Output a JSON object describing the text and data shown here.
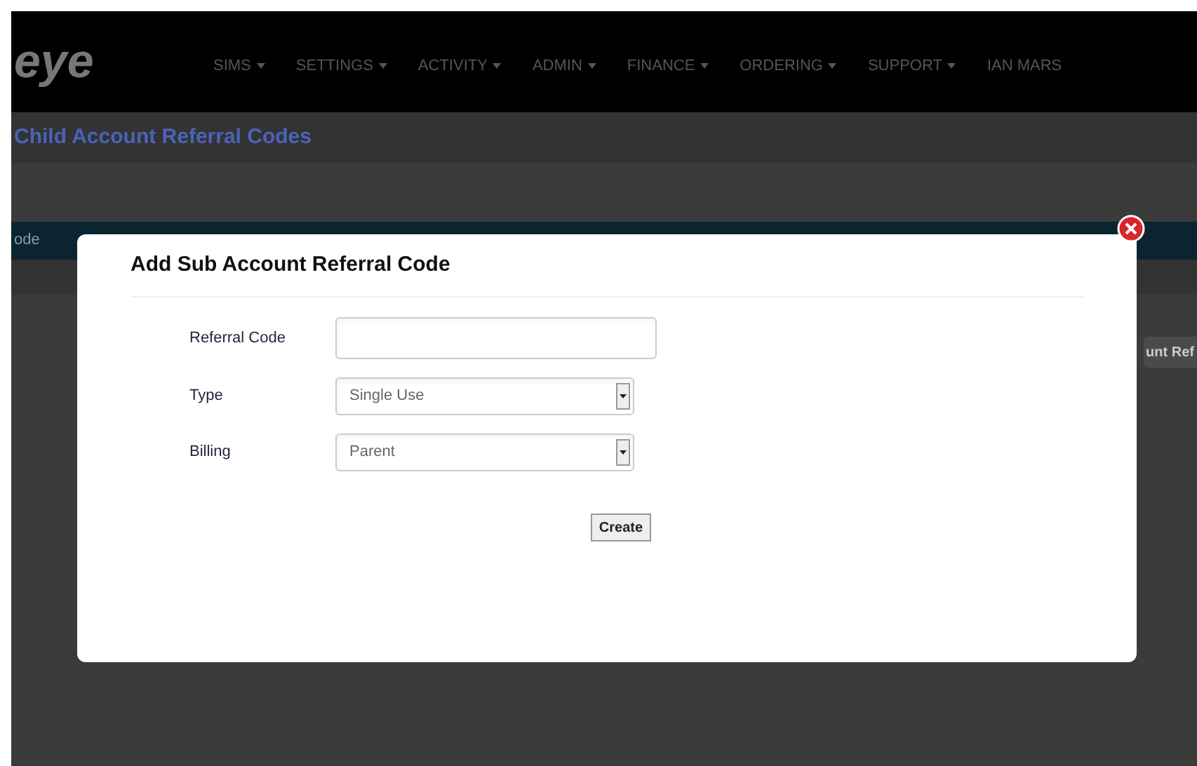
{
  "logo": "eye",
  "nav": [
    {
      "label": "SIMS",
      "dropdown": true
    },
    {
      "label": "SETTINGS",
      "dropdown": true
    },
    {
      "label": "ACTIVITY",
      "dropdown": true
    },
    {
      "label": "ADMIN",
      "dropdown": true
    },
    {
      "label": "FINANCE",
      "dropdown": true
    },
    {
      "label": "ORDERING",
      "dropdown": true
    },
    {
      "label": "SUPPORT",
      "dropdown": true
    },
    {
      "label": "IAN MARS",
      "dropdown": false
    }
  ],
  "page_title": "Child Account Referral Codes",
  "table": {
    "columns": [
      "ode"
    ]
  },
  "side_button": "unt Ref",
  "modal": {
    "title": "Add Sub Account Referral Code",
    "fields": [
      {
        "kind": "text",
        "label": "Referral Code"
      },
      {
        "kind": "select",
        "label": "Type",
        "value": "Single Use"
      },
      {
        "kind": "select",
        "label": "Billing",
        "value": "Parent"
      }
    ],
    "submit": "Create"
  }
}
